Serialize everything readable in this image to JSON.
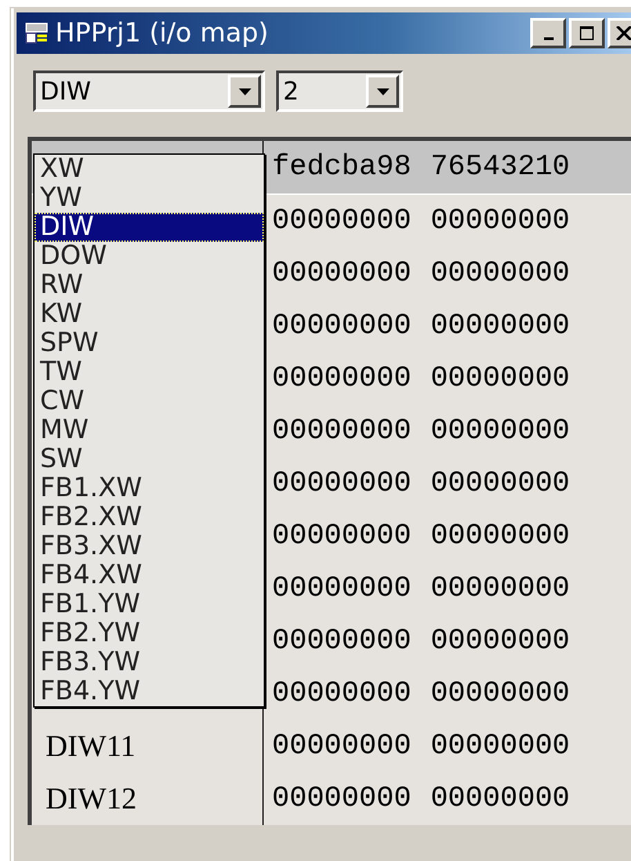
{
  "window": {
    "title": "HPPrj1 (i/o map)"
  },
  "toolbar": {
    "type_combo": {
      "value": "DIW"
    },
    "index_combo": {
      "value": "2"
    }
  },
  "dropdown": {
    "items": [
      {
        "label": "XW",
        "selected": false
      },
      {
        "label": "YW",
        "selected": false
      },
      {
        "label": "DIW",
        "selected": true
      },
      {
        "label": "DOW",
        "selected": false
      },
      {
        "label": "RW",
        "selected": false
      },
      {
        "label": "KW",
        "selected": false
      },
      {
        "label": "SPW",
        "selected": false
      },
      {
        "label": "TW",
        "selected": false
      },
      {
        "label": "CW",
        "selected": false
      },
      {
        "label": "MW",
        "selected": false
      },
      {
        "label": "SW",
        "selected": false
      },
      {
        "label": "FB1.XW",
        "selected": false
      },
      {
        "label": "FB2.XW",
        "selected": false
      },
      {
        "label": "FB3.XW",
        "selected": false
      },
      {
        "label": "FB4.XW",
        "selected": false
      },
      {
        "label": "FB1.YW",
        "selected": false
      },
      {
        "label": "FB2.YW",
        "selected": false
      },
      {
        "label": "FB3.YW",
        "selected": false
      },
      {
        "label": "FB4.YW",
        "selected": false
      }
    ]
  },
  "grid": {
    "header": [
      "fedcba98",
      "76543210"
    ],
    "rows": [
      {
        "values": [
          "00000000",
          "00000000"
        ]
      },
      {
        "values": [
          "00000000",
          "00000000"
        ]
      },
      {
        "values": [
          "00000000",
          "00000000"
        ]
      },
      {
        "values": [
          "00000000",
          "00000000"
        ]
      },
      {
        "values": [
          "00000000",
          "00000000"
        ]
      },
      {
        "values": [
          "00000000",
          "00000000"
        ]
      },
      {
        "values": [
          "00000000",
          "00000000"
        ]
      },
      {
        "values": [
          "00000000",
          "00000000"
        ]
      },
      {
        "values": [
          "00000000",
          "00000000"
        ]
      },
      {
        "values": [
          "00000000",
          "00000000"
        ]
      },
      {
        "label": "DIW11",
        "values": [
          "00000000",
          "00000000"
        ]
      },
      {
        "label": "DIW12",
        "values": [
          "00000000",
          "00000000"
        ]
      }
    ]
  }
}
